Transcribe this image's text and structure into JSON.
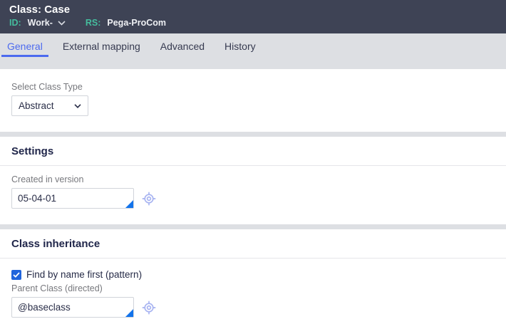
{
  "colors": {
    "header_bg": "#3e4355",
    "header_key_teal": "#45bd9e",
    "tabbar_bg": "#dddfe3",
    "active_tab_blue": "#4c6aef",
    "checkbox_blue": "#2064dc",
    "input_corner_blue": "#1273eb",
    "gear_icon_blue": "#a7b3f1",
    "heading_text": "#20264a"
  },
  "icons": {
    "header_dropdown": "chevron-down-icon",
    "select_dropdown": "chevron-down-icon",
    "field_config": "gear-icon",
    "checkbox_check": "checkmark-icon"
  },
  "header": {
    "title": "Class: Case",
    "id_label": "ID:",
    "id_value": "Work-",
    "rs_label": "RS:",
    "rs_value": "Pega-ProCom"
  },
  "tabs": [
    {
      "label": "General",
      "active": true
    },
    {
      "label": "External mapping",
      "active": false
    },
    {
      "label": "Advanced",
      "active": false
    },
    {
      "label": "History",
      "active": false
    }
  ],
  "class_type": {
    "label": "Select Class Type",
    "value": "Abstract"
  },
  "settings": {
    "heading": "Settings",
    "created_in_version": {
      "label": "Created in version",
      "value": "05-04-01"
    }
  },
  "inheritance": {
    "heading": "Class inheritance",
    "find_by_name": {
      "label": "Find by name first (pattern)",
      "checked": true
    },
    "parent_class": {
      "label": "Parent Class (directed)",
      "value": "@baseclass"
    }
  }
}
